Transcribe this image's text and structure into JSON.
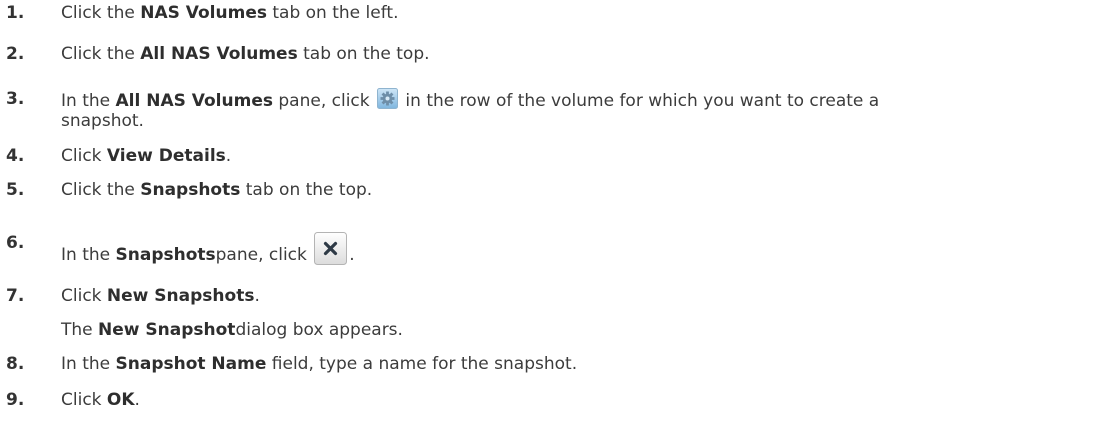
{
  "steps": [
    {
      "num": "1.",
      "a": "Click the ",
      "b": "NAS Volumes",
      "c": " tab on the left."
    },
    {
      "num": "2.",
      "a": "Click the ",
      "b": "All NAS Volumes",
      "c": " tab on the top."
    },
    {
      "num": "3.",
      "a": "In the ",
      "b": "All NAS Volumes",
      "c": " pane, click ",
      "d": " in the row of the volume for which you want to create a",
      "e": "snapshot."
    },
    {
      "num": "4.",
      "a": "Click ",
      "b": "View Details",
      "c": "."
    },
    {
      "num": "5.",
      "a": "Click the ",
      "b": "Snapshots",
      "c": " tab on the top."
    },
    {
      "num": "6.",
      "a": "In the ",
      "b": "Snapshots",
      "c": "pane, click ",
      "d": "."
    },
    {
      "num": "7.",
      "a": "Click ",
      "b": "New Snapshots",
      "c": "."
    },
    {
      "num": "",
      "a": "The ",
      "b": "New Snapshot",
      "c": "dialog box appears."
    },
    {
      "num": "8.",
      "a": "In the ",
      "b": "Snapshot Name",
      "c": " field, type a name for the snapshot."
    },
    {
      "num": "9.",
      "a": "Click ",
      "b": "OK",
      "c": "."
    }
  ],
  "icons": {
    "gear": "gear-icon",
    "delete": "close-icon"
  }
}
